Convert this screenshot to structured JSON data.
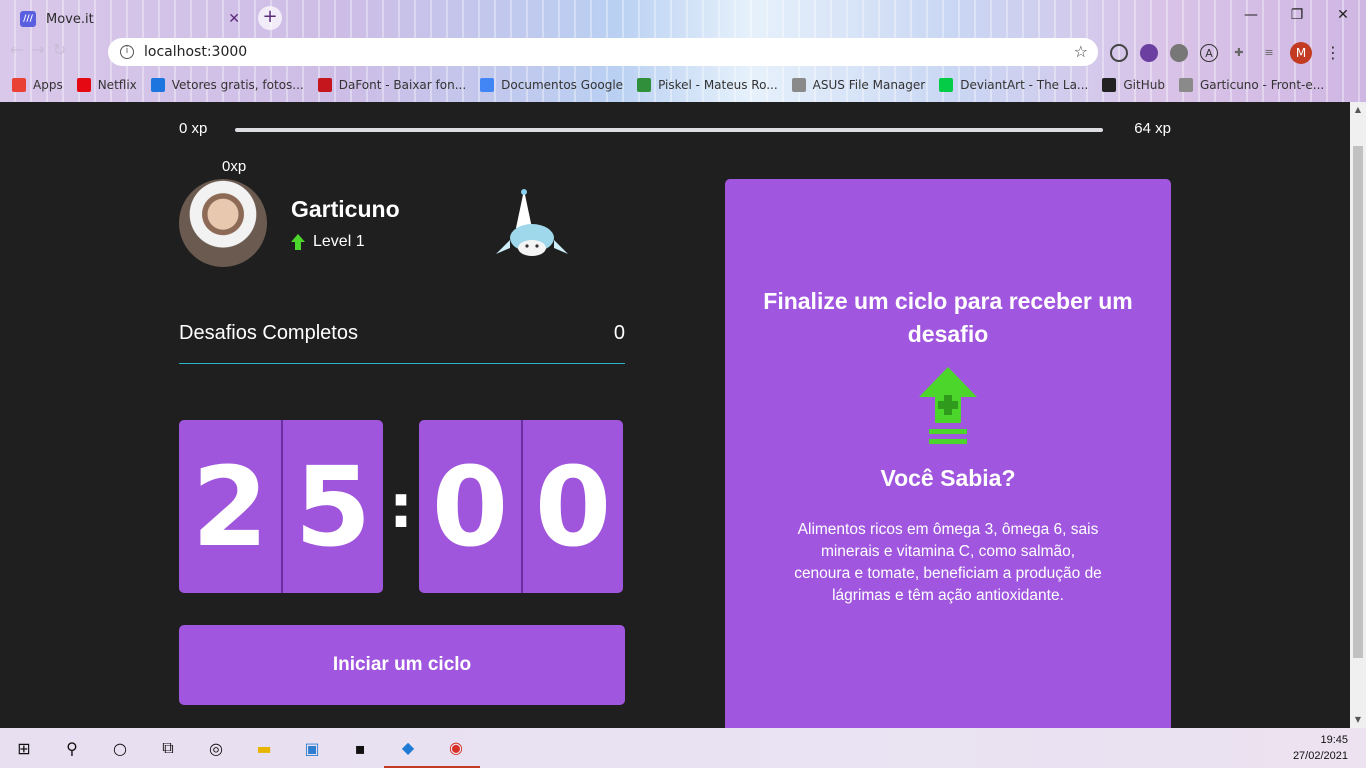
{
  "browser": {
    "tab_title": "Move.it",
    "url": "localhost:3000",
    "bookmarks": [
      {
        "label": "Apps",
        "icon": "apps-grid-icon",
        "color": "#e94235"
      },
      {
        "label": "Netflix",
        "icon": "netflix-icon",
        "color": "#e50914"
      },
      {
        "label": "Vetores gratis, fotos...",
        "icon": "freepik-icon",
        "color": "#1d75e0"
      },
      {
        "label": "DaFont - Baixar fon...",
        "icon": "dafont-icon",
        "color": "#c4161c"
      },
      {
        "label": "Documentos Google",
        "icon": "google-docs-icon",
        "color": "#4285f4"
      },
      {
        "label": "Piskel - Mateus Ro...",
        "icon": "piskel-icon",
        "color": "#2f8f3a"
      },
      {
        "label": "ASUS File Manager",
        "icon": "globe-icon",
        "color": "#8a8a8a"
      },
      {
        "label": "DeviantArt - The La...",
        "icon": "deviantart-icon",
        "color": "#05cc47"
      },
      {
        "label": "GitHub",
        "icon": "github-icon",
        "color": "#222222"
      },
      {
        "label": "Garticuno - Front-e...",
        "icon": "globe-icon",
        "color": "#8a8a8a"
      }
    ],
    "profile_initial": "M"
  },
  "xp": {
    "start": "0 xp",
    "end": "64 xp",
    "current": "0xp",
    "progress": 0
  },
  "profile": {
    "name": "Garticuno",
    "level": "Level 1"
  },
  "challenges": {
    "label": "Desafios Completos",
    "count": "0"
  },
  "countdown": {
    "minutes": [
      "2",
      "5"
    ],
    "separator": ":",
    "seconds": [
      "0",
      "0"
    ]
  },
  "start_button": {
    "label": "Iniciar um ciclo"
  },
  "challenge_card": {
    "title": "Finalize um ciclo para receber um desafio",
    "subtitle": "Você Sabia?",
    "text": "Alimentos ricos em ômega 3, ômega 6, sais minerais e vitamina C, como salmão, cenoura e tomate, beneficiam a produção de lágrimas e têm ação antioxidante."
  },
  "taskbar": {
    "time": "19:45",
    "date": "27/02/2021"
  },
  "colors": {
    "accent": "#a056df",
    "background": "#1f1f1f",
    "level_green": "#4cd62b",
    "divider": "#2ab3c6"
  }
}
